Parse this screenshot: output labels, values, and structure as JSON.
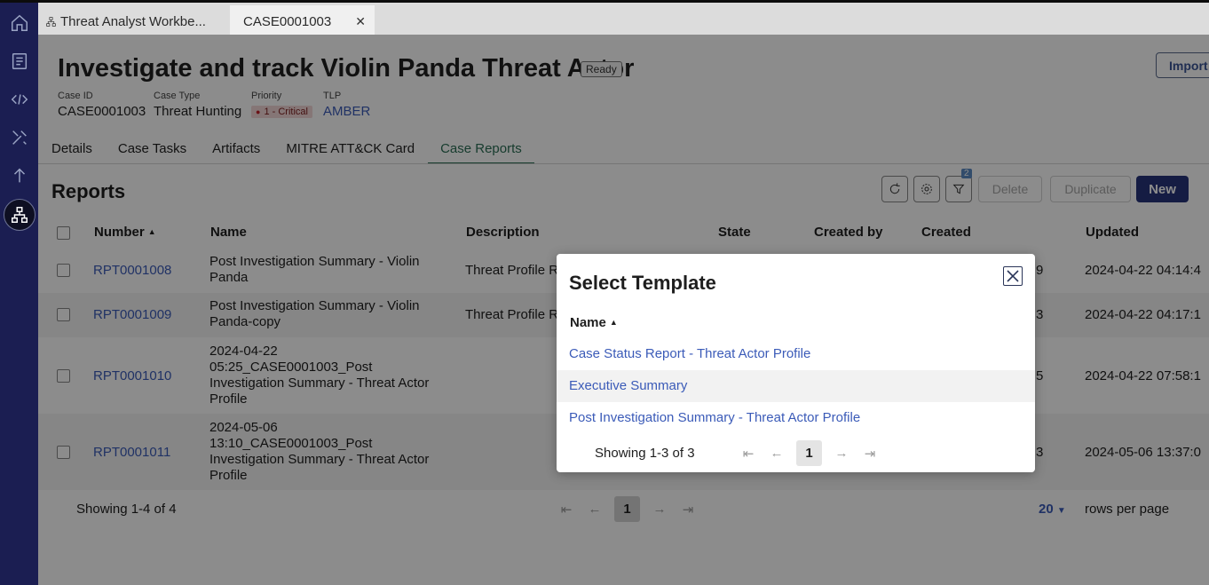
{
  "tabs": [
    {
      "label": "Threat Analyst Workbe..."
    },
    {
      "label": "CASE0001003"
    }
  ],
  "header": {
    "title": "Investigate and track Violin Panda Threat Actor",
    "status": "Ready",
    "import_label": "Import"
  },
  "meta": {
    "case_id_label": "Case ID",
    "case_id": "CASE0001003",
    "case_type_label": "Case Type",
    "case_type": "Threat Hunting",
    "priority_label": "Priority",
    "priority": "1 - Critical",
    "tlp_label": "TLP",
    "tlp": "AMBER"
  },
  "subtabs": [
    "Details",
    "Case Tasks",
    "Artifacts",
    "MITRE ATT&CK Card",
    "Case Reports"
  ],
  "reports": {
    "heading": "Reports",
    "filter_count": "2",
    "delete_label": "Delete",
    "duplicate_label": "Duplicate",
    "new_label": "New",
    "columns": [
      "Number",
      "Name",
      "Description",
      "State",
      "Created by",
      "Created",
      "Updated"
    ],
    "rows": [
      {
        "number": "RPT0001008",
        "name": [
          "Post Investigation Summary - Violin",
          "Panda"
        ],
        "description": "Threat Profile Re",
        "created": "9",
        "updated": "2024-04-22 04:14:4"
      },
      {
        "number": "RPT0001009",
        "name": [
          "Post Investigation Summary - Violin",
          "Panda-copy"
        ],
        "description": "Threat Profile Re",
        "created": "3",
        "updated": "2024-04-22 04:17:1"
      },
      {
        "number": "RPT0001010",
        "name": [
          "2024-04-22",
          "05:25_CASE0001003_Post",
          "Investigation Summary - Threat Actor",
          "Profile"
        ],
        "description": "",
        "created": "5",
        "updated": "2024-04-22 07:58:1"
      },
      {
        "number": "RPT0001011",
        "name": [
          "2024-05-06",
          "13:10_CASE0001003_Post",
          "Investigation Summary - Threat Actor",
          "Profile"
        ],
        "description": "",
        "created": "3",
        "updated": "2024-05-06 13:37:0"
      }
    ],
    "showing": "Showing 1-4 of 4",
    "page": "1",
    "rows_per_page": "20",
    "rows_per_page_label": "rows per page"
  },
  "modal": {
    "title": "Select Template",
    "column": "Name",
    "templates": [
      "Case Status Report - Threat Actor Profile",
      "Executive Summary",
      "Post Investigation Summary - Threat Actor Profile"
    ],
    "showing": "Showing 1-3 of 3",
    "page": "1"
  }
}
